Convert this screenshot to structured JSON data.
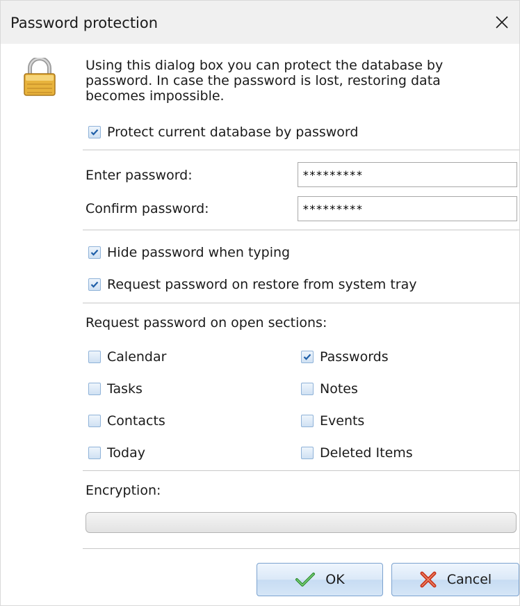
{
  "window": {
    "title": "Password protection"
  },
  "intro_text": "Using this dialog box you can protect the database by password. In case the password is lost, restoring data becomes impossible.",
  "protect": {
    "label": "Protect current database by password",
    "checked": true
  },
  "enter_password": {
    "label": "Enter password:",
    "value": "*********"
  },
  "confirm_password": {
    "label": "Confirm password:",
    "value": "*********"
  },
  "hide_password": {
    "label": "Hide password when typing",
    "checked": true
  },
  "request_tray": {
    "label": "Request password on restore from system tray",
    "checked": true
  },
  "sections": {
    "heading": "Request password on open sections:",
    "items": [
      {
        "label": "Calendar",
        "checked": false
      },
      {
        "label": "Passwords",
        "checked": true
      },
      {
        "label": "Tasks",
        "checked": false
      },
      {
        "label": "Notes",
        "checked": false
      },
      {
        "label": "Contacts",
        "checked": false
      },
      {
        "label": "Events",
        "checked": false
      },
      {
        "label": "Today",
        "checked": false
      },
      {
        "label": "Deleted Items",
        "checked": false
      }
    ]
  },
  "encryption": {
    "label": "Encryption:",
    "progress": 0
  },
  "buttons": {
    "ok": "OK",
    "cancel": "Cancel"
  },
  "colors": {
    "checkbox_border": "#8fb2d8",
    "check_mark": "#1f5fa8",
    "button_border": "#7ba2cf",
    "lock_gold": "#e8b33c"
  },
  "icons": [
    "lock-icon",
    "close-icon",
    "check-icon",
    "cross-icon"
  ]
}
